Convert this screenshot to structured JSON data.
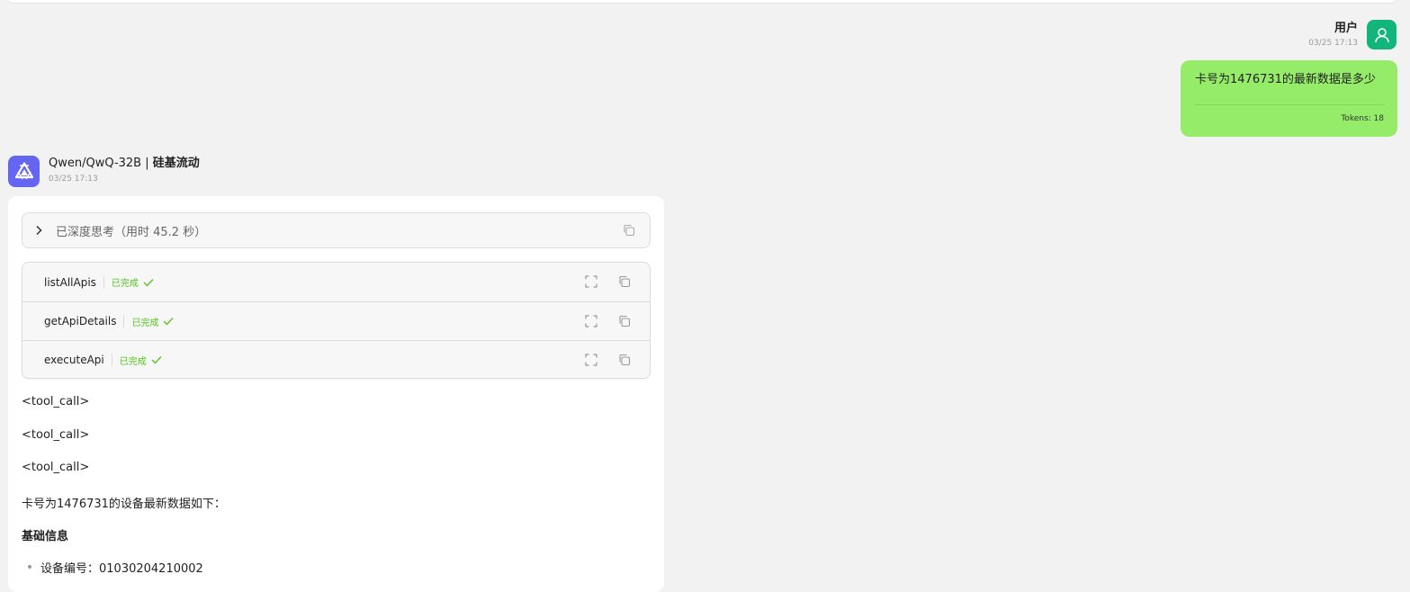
{
  "user_message": {
    "name": "用户",
    "time": "03/25 17:13",
    "text": "卡号为1476731的最新数据是多少",
    "tokens": "Tokens: 18",
    "icon": "user-icon"
  },
  "assistant": {
    "model": "Qwen/QwQ-32B",
    "separator": "|",
    "provider": "硅基流动",
    "time": "03/25 17:13",
    "icon": "qwen-logo-icon",
    "thinking": {
      "label": "已深度思考（用时 45.2 秒）",
      "expand_icon": "chevron-right-icon",
      "copy_icon": "copy-icon"
    },
    "tools": [
      {
        "name": "listAllApis",
        "status": "已完成"
      },
      {
        "name": "getApiDetails",
        "status": "已完成"
      },
      {
        "name": "executeApi",
        "status": "已完成"
      }
    ],
    "lines": [
      "<tool_call>",
      "<tool_call>",
      "<tool_call>",
      "卡号为1476731的设备最新数据如下：",
      "基础信息"
    ],
    "list_items": [
      "设备编号：01030204210002"
    ]
  },
  "colors": {
    "background": "#f2f2f2",
    "user_bubble": "#95ec69",
    "user_avatar": "#12b67a",
    "bot_avatar": "#6466f1",
    "success": "#52c41a"
  }
}
